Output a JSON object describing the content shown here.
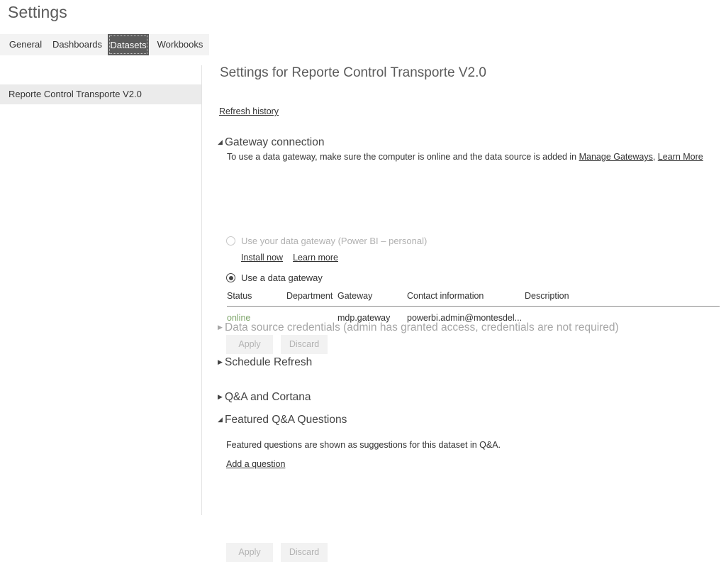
{
  "page_title": "Settings",
  "tabs": [
    {
      "id": "general",
      "label": "General",
      "selected": false
    },
    {
      "id": "dashboards",
      "label": "Dashboards",
      "selected": false
    },
    {
      "id": "datasets",
      "label": "Datasets",
      "selected": true
    },
    {
      "id": "workbooks",
      "label": "Workbooks",
      "selected": false
    }
  ],
  "sidebar": {
    "items": [
      {
        "label": "Reporte Control Transporte V2.0",
        "selected": true
      }
    ]
  },
  "content": {
    "title": "Settings for Reporte Control Transporte V2.0",
    "refresh_history_label": "Refresh history",
    "sections": {
      "gateway": {
        "header": "Gateway connection",
        "expanded_marker": "◢",
        "description_prefix": "To use a data gateway, make sure the computer is online and the data source is added in ",
        "manage_gateways_link": "Manage Gateways",
        "description_separator": ", ",
        "learn_more_link": "Learn More",
        "radio_personal": {
          "label": "Use your data gateway (Power BI – personal)",
          "checked": false,
          "disabled": true
        },
        "personal_links": {
          "install_now": "Install now",
          "learn_more": "Learn more"
        },
        "radio_gateway": {
          "label": "Use a data gateway",
          "checked": true,
          "disabled": false
        },
        "table": {
          "columns": [
            "Status",
            "Department",
            "Gateway",
            "Contact information",
            "Description"
          ],
          "rows": [
            {
              "status": "online",
              "department": "",
              "gateway": "mdp.gateway",
              "contact": "powerbi.admin@montesdel...",
              "description": ""
            }
          ],
          "status_color": "#7ea56a"
        },
        "buttons": {
          "apply": "Apply",
          "discard": "Discard"
        }
      },
      "credentials": {
        "header": "Data source credentials (admin has granted access, credentials are not required)",
        "collapsed_marker": "▶",
        "muted": true
      },
      "schedule_refresh": {
        "header": "Schedule Refresh",
        "collapsed_marker": "▶",
        "muted": false
      },
      "qna_cortana": {
        "header": "Q&A and Cortana",
        "collapsed_marker": "▶",
        "muted": false
      },
      "featured_qna": {
        "header": "Featured Q&A Questions",
        "expanded_marker": "◢",
        "description": "Featured questions are shown as suggestions for this dataset in Q&A.",
        "add_question_link": "Add a question",
        "buttons": {
          "apply": "Apply",
          "discard": "Discard"
        }
      }
    }
  },
  "colors": {
    "tab_selected_bg": "#5c5c5c",
    "tabstrip_bg": "#f3f3f3",
    "sidebar_selected_bg": "#ebebeb",
    "text": "#333333",
    "muted_text": "#a6a6a6",
    "status_online": "#7ea56a",
    "button_bg": "#f2f2f2",
    "button_text": "#b3b3b3"
  }
}
